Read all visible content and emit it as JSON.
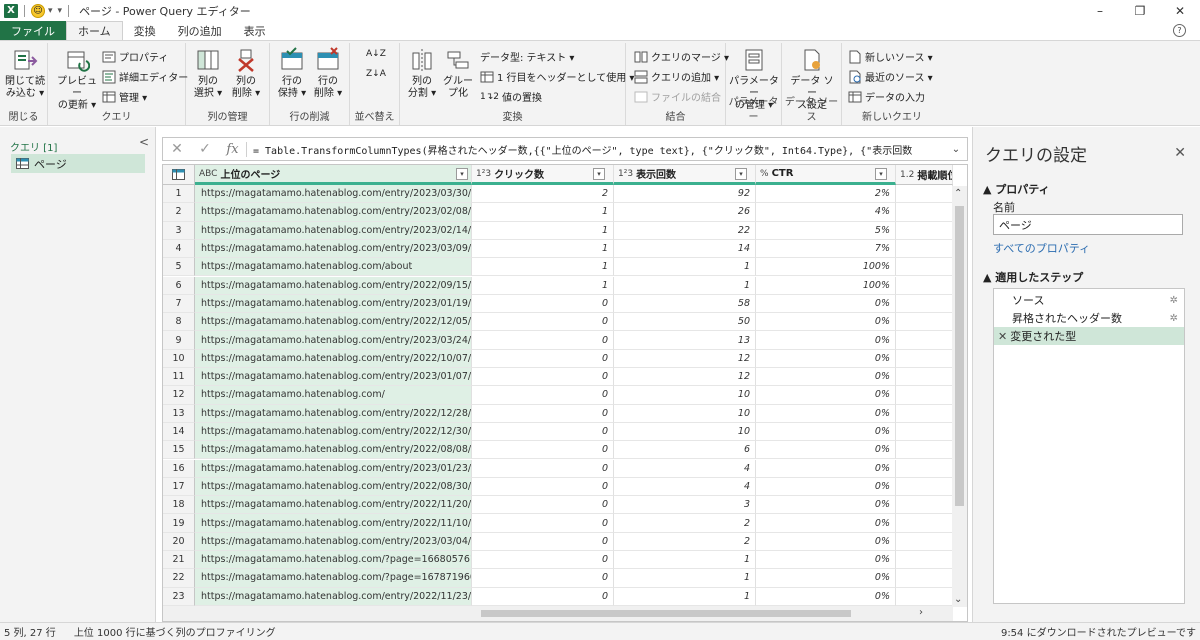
{
  "titlebar": {
    "logo": "X",
    "title": "ページ - Power Query エディター",
    "controls": [
      "–",
      "❐",
      "✕"
    ]
  },
  "tabs": [
    "ファイル",
    "ホーム",
    "変換",
    "列の追加",
    "表示"
  ],
  "help": "?",
  "ribbon": {
    "close": {
      "btn": "閉じて読\nみ込む ▾",
      "label": "閉じる"
    },
    "query": {
      "preview": "プレビュー\nの更新 ▾",
      "properties": "プロパティ",
      "advanced": "詳細エディター",
      "manage": "管理 ▾",
      "label": "クエリ"
    },
    "columns": {
      "choose": "列の\n選択 ▾",
      "remove": "列の\n削除 ▾",
      "label": "列の管理"
    },
    "rows": {
      "keep": "行の\n保持 ▾",
      "remove": "行の\n削除 ▾",
      "label": "行の削減"
    },
    "sort": {
      "label": "並べ替え"
    },
    "transform": {
      "split": "列の\n分割 ▾",
      "group": "グルー\nプ化",
      "datatype": "データ型: テキスト ▾",
      "header": "1 行目をヘッダーとして使用 ▾",
      "replace": "値の置換",
      "label": "変換"
    },
    "combine": {
      "merge": "クエリのマージ ▾",
      "append": "クエリの追加 ▾",
      "files": "ファイルの結合",
      "label": "結合"
    },
    "params": {
      "manage": "パラメーター\nの管理 ▾",
      "label": "パラメーター"
    },
    "datasource": {
      "settings": "データ ソー\nス設定",
      "label": "データ ソース"
    },
    "newquery": {
      "new": "新しいソース ▾",
      "recent": "最近のソース ▾",
      "enter": "データの入力",
      "label": "新しいクエリ"
    }
  },
  "leftpanel": {
    "header": "クエリ [1]",
    "collapse": "<",
    "item": "ページ"
  },
  "formula": {
    "cancel": "✕",
    "confirm": "✓",
    "fx": "fx",
    "text": "= Table.TransformColumnTypes(昇格されたヘッダー数,{{\"上位のページ\", type text}, {\"クリック数\", Int64.Type}, {\"表示回数",
    "expand": "⌄"
  },
  "grid": {
    "headers": [
      {
        "type": "ABC",
        "name": "上位のページ"
      },
      {
        "type": "1²3",
        "name": "クリック数"
      },
      {
        "type": "1²3",
        "name": "表示回数"
      },
      {
        "type": "%",
        "name": "CTR"
      },
      {
        "type": "1.2",
        "name": "掲載順位"
      }
    ],
    "rows": [
      [
        "1",
        "https://magatamamo.hatenablog.com/entry/2023/03/30/224...",
        "2",
        "92",
        "2%"
      ],
      [
        "2",
        "https://magatamamo.hatenablog.com/entry/2023/02/08/232...",
        "1",
        "26",
        "4%"
      ],
      [
        "3",
        "https://magatamamo.hatenablog.com/entry/2023/02/14/145...",
        "1",
        "22",
        "5%"
      ],
      [
        "4",
        "https://magatamamo.hatenablog.com/entry/2023/03/09/231...",
        "1",
        "14",
        "7%"
      ],
      [
        "5",
        "https://magatamamo.hatenablog.com/about",
        "1",
        "1",
        "100%"
      ],
      [
        "6",
        "https://magatamamo.hatenablog.com/entry/2022/09/15/182...",
        "1",
        "1",
        "100%"
      ],
      [
        "7",
        "https://magatamamo.hatenablog.com/entry/2023/01/19/215...",
        "0",
        "58",
        "0%"
      ],
      [
        "8",
        "https://magatamamo.hatenablog.com/entry/2022/12/05/172...",
        "0",
        "50",
        "0%"
      ],
      [
        "9",
        "https://magatamamo.hatenablog.com/entry/2023/03/24/130...",
        "0",
        "13",
        "0%"
      ],
      [
        "10",
        "https://magatamamo.hatenablog.com/entry/2022/10/07/113...",
        "0",
        "12",
        "0%"
      ],
      [
        "11",
        "https://magatamamo.hatenablog.com/entry/2023/01/07/134...",
        "0",
        "12",
        "0%"
      ],
      [
        "12",
        "https://magatamamo.hatenablog.com/",
        "0",
        "10",
        "0%"
      ],
      [
        "13",
        "https://magatamamo.hatenablog.com/entry/2022/12/28/111...",
        "0",
        "10",
        "0%"
      ],
      [
        "14",
        "https://magatamamo.hatenablog.com/entry/2022/12/30/152...",
        "0",
        "10",
        "0%"
      ],
      [
        "15",
        "https://magatamamo.hatenablog.com/entry/2022/08/08/142...",
        "0",
        "6",
        "0%"
      ],
      [
        "16",
        "https://magatamamo.hatenablog.com/entry/2023/01/23/143...",
        "0",
        "4",
        "0%"
      ],
      [
        "17",
        "https://magatamamo.hatenablog.com/entry/2022/08/30/145...",
        "0",
        "4",
        "0%"
      ],
      [
        "18",
        "https://magatamamo.hatenablog.com/entry/2022/11/20/224...",
        "0",
        "3",
        "0%"
      ],
      [
        "19",
        "https://magatamamo.hatenablog.com/entry/2022/11/10/142...",
        "0",
        "2",
        "0%"
      ],
      [
        "20",
        "https://magatamamo.hatenablog.com/entry/2023/03/04/000...",
        "0",
        "2",
        "0%"
      ],
      [
        "21",
        "https://magatamamo.hatenablog.com/?page=1668057616",
        "0",
        "1",
        "0%"
      ],
      [
        "22",
        "https://magatamamo.hatenablog.com/?page=1678719600",
        "0",
        "1",
        "0%"
      ],
      [
        "23",
        "https://magatamamo.hatenablog.com/entry/2022/11/23/235...",
        "0",
        "1",
        "0%"
      ]
    ]
  },
  "rightpanel": {
    "title": "クエリの設定",
    "close": "✕",
    "properties_section": "▲ プロパティ",
    "name_label": "名前",
    "name_value": "ページ",
    "all_properties": "すべてのプロパティ",
    "steps_section": "▲ 適用したステップ",
    "steps": [
      {
        "name": "ソース",
        "gear": true,
        "selected": false
      },
      {
        "name": "昇格されたヘッダー数",
        "gear": true,
        "selected": false
      },
      {
        "name": "変更された型",
        "gear": false,
        "selected": true
      }
    ]
  },
  "statusbar": {
    "left": "5 列, 27 行",
    "mid": "上位 1000 行に基づく列のプロファイリング",
    "right": "9:54 にダウンロードされたプレビューです"
  },
  "colors": {
    "excel_green": "#217346",
    "selected_bg": "#cfe6d8",
    "header_underline": "#3bb08f",
    "link_blue": "#2b6cb0"
  }
}
